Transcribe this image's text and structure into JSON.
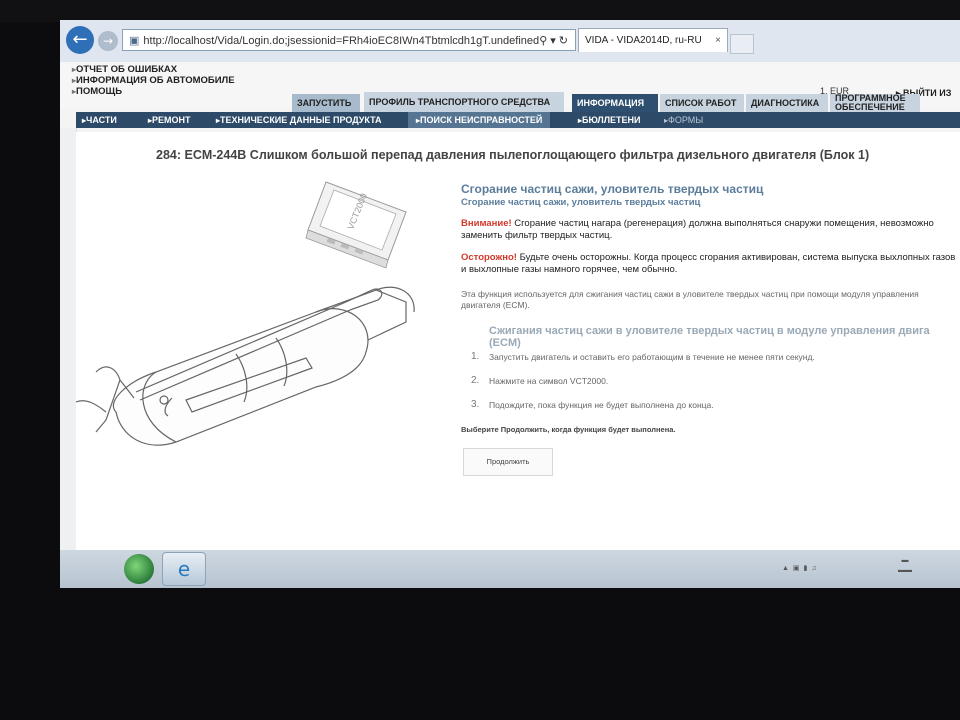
{
  "browser": {
    "url": "http://localhost/Vida/Login.do;jsessionid=FRh4ioEC8IWn4Tbtmlcdh1gT.undefined",
    "tab_title": "VIDA - VIDA2014D, ru-RU",
    "tab_close": "×"
  },
  "header": {
    "menu": [
      "ОТЧЕТ ОБ ОШИБКАХ",
      "ИНФОРМАЦИЯ ОБ АВТОМОБИЛЕ",
      "ПОМОЩЬ"
    ],
    "currency": "1, EUR",
    "logout": "ВЫЙТИ ИЗ"
  },
  "main_tabs": [
    {
      "label": "ЗАПУСТИТЬ"
    },
    {
      "label": "ПРОФИЛЬ ТРАНСПОРТНОГО СРЕДСТВА"
    },
    {
      "label": "ИНФОРМАЦИЯ"
    },
    {
      "label": "СПИСОК РАБОТ"
    },
    {
      "label": "ДИАГНОСТИКА"
    },
    {
      "label": "ПРОГРАММНОЕ ОБЕСПЕЧЕНИЕ"
    }
  ],
  "subnav": [
    {
      "label": "ЧАСТИ"
    },
    {
      "label": "РЕМОНТ"
    },
    {
      "label": "ТЕХНИЧЕСКИЕ ДАННЫЕ ПРОДУКТА"
    },
    {
      "label": "ПОИСК НЕИСПРАВНОСТЕЙ"
    },
    {
      "label": "БЮЛЛЕТЕНИ"
    },
    {
      "label": "ФОРМЫ"
    }
  ],
  "content": {
    "title": "284: ECM-244B Слишком большой перепад давления пылепоглощающего фильтра дизельного двигателя (Блок 1)",
    "heading": "Сгорание частиц сажи, уловитель твердых частиц",
    "subheading": "Сгорание частиц сажи, уловитель твердых частиц",
    "warning_label": "Внимание!",
    "warning_text": " Сгорание частиц нагара (регенерация) должна выполняться снаружи помещения, невозможно заменить фильтр твердых частиц.",
    "caution_label": "Осторожно!",
    "caution_text": " Будьте очень осторожны. Когда процесс сгорания активирован, система выпуска выхлопных газов и выхлопные газы намного горячее, чем обычно.",
    "description": "Эта функция используется для сжигания частиц сажи в уловителе твердых частиц при помощи модуля управления двигателя (ECM).",
    "steps_heading": "Сжигания частиц сажи в уловителе твердых частиц в модуле управления двига (ECM)",
    "steps": [
      {
        "num": "1.",
        "text": "Запустить двигатель и оставить его работающим в течение не менее пяти секунд."
      },
      {
        "num": "2.",
        "text": "Нажмите на символ VCT2000."
      },
      {
        "num": "3.",
        "text": "Подождите, пока функция не будет выполнена до конца."
      }
    ],
    "choose_text": "Выберите Продолжить, когда функция будет выполнена.",
    "continue_label": "Продолжить",
    "device_label": "VCT2000"
  }
}
